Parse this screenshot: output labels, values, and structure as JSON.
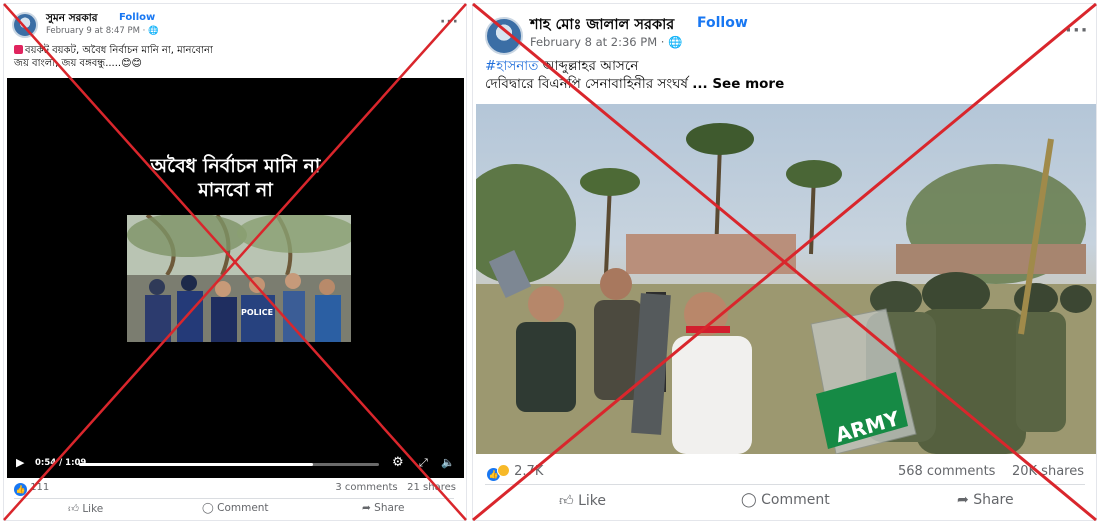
{
  "left_post": {
    "author": "সুমন সরকার",
    "follow": "Follow",
    "meta": "February 9 at 8:47 PM · 🌐",
    "more": "···",
    "caption_line1": "বয়কট বয়কট, অবৈধ নির্বাচন মানি না, মানবোনা",
    "caption_line2": "জয় বাংলা, জয় বঙ্গবন্ধু.....😊😊",
    "video_overlay_line1": "অবৈধ নির্বাচন মানি না",
    "video_overlay_line2": "মানবো না",
    "video_frame_text": "POLICE",
    "time": "0:54 / 1:09",
    "progress": 0.78,
    "reactions_count": "111",
    "comments": "3 comments",
    "shares": "21 shares",
    "like_label": "Like",
    "comment_label": "Comment",
    "share_label": "Share"
  },
  "right_post": {
    "author": "শাহ মোঃ জালাল সরকার",
    "follow": "Follow",
    "meta": "February 8 at 2:36 PM · 🌐",
    "more": "···",
    "caption_tag": "#হাসনাত",
    "caption_rest": " আব্দুল্লাহর আসনে",
    "caption_line2": "দেবিদ্বারে বিএনপি সেনাবাহিনীর সংঘর্ষ",
    "see_more": "... See more",
    "image_shield_text": "ARMY",
    "reactions_count": "2.7K",
    "comments": "568 comments",
    "shares": "20K shares",
    "like_label": "Like",
    "comment_label": "Comment",
    "share_label": "Share"
  },
  "colors": {
    "facebook_blue": "#1877f2",
    "cross_red": "#d9262c",
    "meta_gray": "#65676b"
  }
}
